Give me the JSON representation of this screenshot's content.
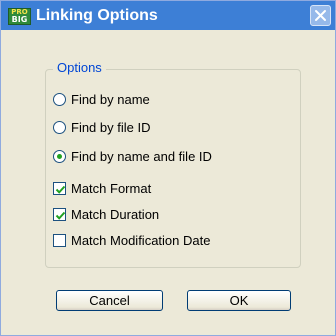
{
  "window": {
    "title": "Linking Options",
    "icon": {
      "name": "pro-app-icon",
      "top_text": "PRO",
      "bottom_text": "BIG"
    },
    "close_icon": "close-x-icon"
  },
  "options_group": {
    "label": "Options",
    "radios": [
      {
        "label": "Find by name",
        "selected": false
      },
      {
        "label": "Find by file ID",
        "selected": false
      },
      {
        "label": "Find by name and file ID",
        "selected": true
      }
    ],
    "checkboxes": [
      {
        "label": "Match Format",
        "checked": true
      },
      {
        "label": "Match Duration",
        "checked": true
      },
      {
        "label": "Match Modification Date",
        "checked": false
      }
    ]
  },
  "buttons": {
    "cancel_label": "Cancel",
    "ok_label": "OK"
  },
  "colors": {
    "titlebar": "#3d7fd6",
    "dialog_bg": "#ece9d8",
    "group_label": "#0046d5",
    "radio_dot": "#21a121",
    "check_mark": "#21a121"
  }
}
